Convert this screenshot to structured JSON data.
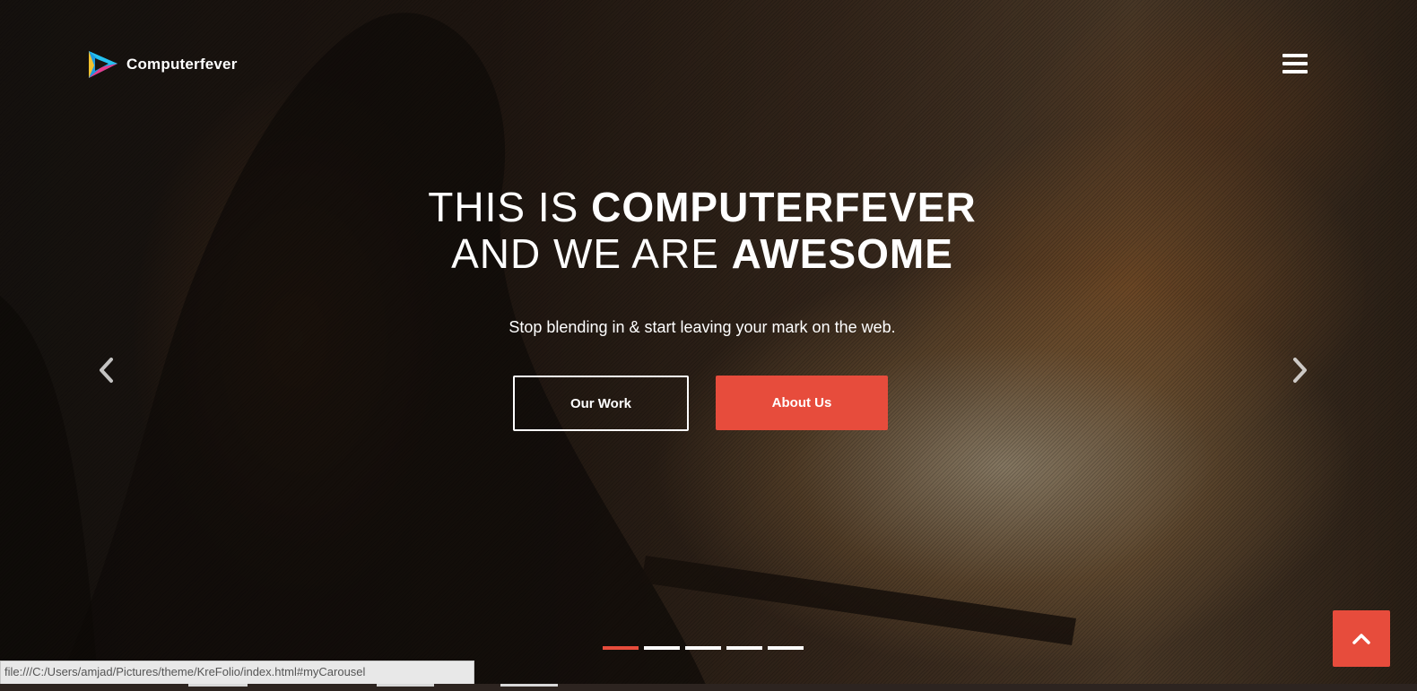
{
  "brand": {
    "name": "Computerfever",
    "logo_icon": "play-triangle-icon"
  },
  "header": {
    "menu_icon": "hamburger-icon"
  },
  "hero": {
    "line1_light": "THIS IS ",
    "line1_bold": "COMPUTERFEVER",
    "line2_light": "AND WE ARE ",
    "line2_bold": "AWESOME",
    "tagline": "Stop blending in & start leaving your mark on the web.",
    "primary_button": "Our Work",
    "secondary_button": "About Us"
  },
  "carousel": {
    "prev_icon": "chevron-left-icon",
    "next_icon": "chevron-right-icon",
    "slide_count": 5,
    "active_index": 0
  },
  "back_to_top_icon": "chevron-up-icon",
  "status_bar": {
    "url": "file:///C:/Users/amjad/Pictures/theme/KreFolio/index.html#myCarousel"
  },
  "colors": {
    "accent": "#e74c3c",
    "text": "#ffffff"
  }
}
